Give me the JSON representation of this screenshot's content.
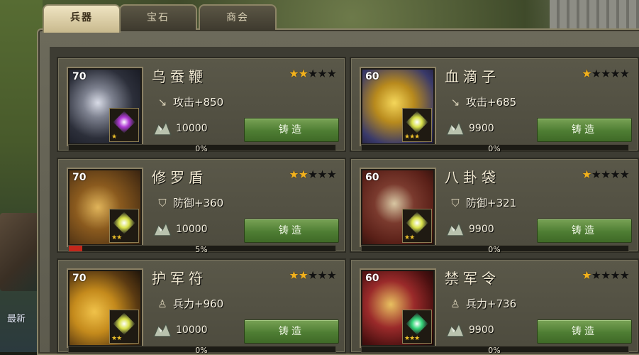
{
  "tabs": [
    {
      "label": "兵器",
      "active": true
    },
    {
      "label": "宝石",
      "active": false
    },
    {
      "label": "商会",
      "active": false
    }
  ],
  "sidebar": {
    "news_label": "最新"
  },
  "forge_label": "铸造",
  "items": [
    {
      "level": "70",
      "name": "乌蚕鞭",
      "stars": 2,
      "stat_icon": "sword-icon",
      "stat": "攻击+850",
      "cost": "10000",
      "progress_label": "0%",
      "progress": 0,
      "gem_color": "#b03ad6",
      "gem_stars": 1
    },
    {
      "level": "60",
      "name": "血滴子",
      "stars": 1,
      "stat_icon": "sword-icon",
      "stat": "攻击+685",
      "cost": "9900",
      "progress_label": "0%",
      "progress": 0,
      "gem_color": "#d9e24a",
      "gem_stars": 3
    },
    {
      "level": "70",
      "name": "修罗盾",
      "stars": 2,
      "stat_icon": "shield-icon",
      "stat": "防御+360",
      "cost": "10000",
      "progress_label": "5%",
      "progress": 5,
      "gem_color": "#d9e24a",
      "gem_stars": 2
    },
    {
      "level": "60",
      "name": "八卦袋",
      "stars": 1,
      "stat_icon": "shield-icon",
      "stat": "防御+321",
      "cost": "9900",
      "progress_label": "0%",
      "progress": 0,
      "gem_color": "#d9e24a",
      "gem_stars": 2
    },
    {
      "level": "70",
      "name": "护军符",
      "stars": 2,
      "stat_icon": "soldier-icon",
      "stat": "兵力+960",
      "cost": "10000",
      "progress_label": "0%",
      "progress": 0,
      "gem_color": "#d9e24a",
      "gem_stars": 2
    },
    {
      "level": "60",
      "name": "禁军令",
      "stars": 1,
      "stat_icon": "soldier-icon",
      "stat": "兵力+736",
      "cost": "9900",
      "progress_label": "0%",
      "progress": 0,
      "gem_color": "#36d67a",
      "gem_stars": 3
    }
  ],
  "colors": {
    "star_on": "#f2b11d",
    "forge_button": "#4e7d33",
    "progress_fill": "#c3271b"
  }
}
